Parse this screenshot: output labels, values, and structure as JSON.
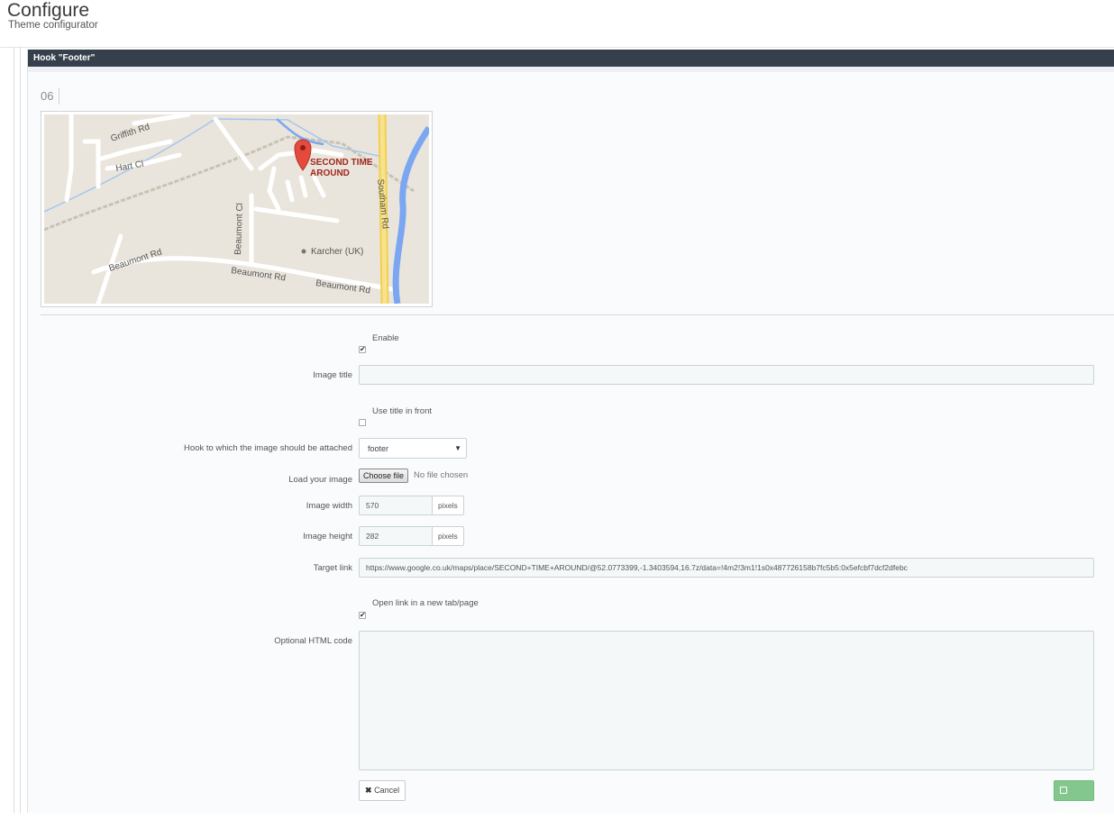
{
  "header": {
    "title": "Configure",
    "subtitle": "Theme configurator"
  },
  "panel": {
    "title": "Hook \"Footer\"",
    "index": "06"
  },
  "map": {
    "place_name_line1": "SECOND TIME",
    "place_name_line2": "AROUND",
    "streets": [
      "Griffith Rd",
      "Hart Cl",
      "Beaumont Cl",
      "Beaumont Rd",
      "Beaumont Rd",
      "Beaumont Rd",
      "Southam Rd"
    ],
    "poi": "Karcher (UK)"
  },
  "form": {
    "enable": {
      "label": "Enable",
      "checked": true
    },
    "image_title": {
      "label": "Image title",
      "value": ""
    },
    "use_title": {
      "label": "Use title in front",
      "checked": false
    },
    "hook": {
      "label": "Hook to which the image should be attached",
      "selected": "footer"
    },
    "load_image": {
      "label": "Load your image",
      "button": "Choose file",
      "status": "No file chosen"
    },
    "width": {
      "label": "Image width",
      "value": "570",
      "unit": "pixels"
    },
    "height": {
      "label": "Image height",
      "value": "282",
      "unit": "pixels"
    },
    "target": {
      "label": "Target link",
      "value": "https://www.google.co.uk/maps/place/SECOND+TIME+AROUND/@52.0773399,-1.3403594,16.7z/data=!4m2!3m1!1s0x487726158b7fc5b5:0x5efcbf7dcf2dfebc"
    },
    "new_tab": {
      "label": "Open link in a new tab/page",
      "checked": true
    },
    "html_code": {
      "label": "Optional HTML code",
      "value": ""
    }
  },
  "actions": {
    "cancel": "Cancel",
    "save": "Save"
  },
  "colors": {
    "panel_header": "#363f4c",
    "save_button": "#84c78e"
  }
}
